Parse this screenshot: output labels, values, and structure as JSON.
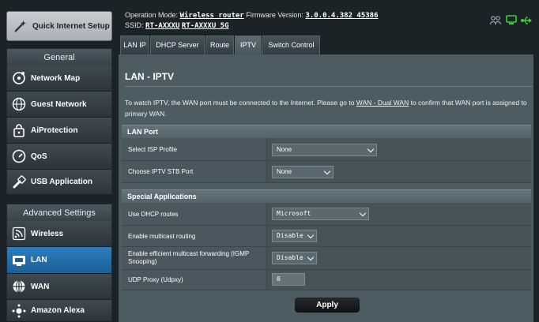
{
  "sidebar": {
    "quick_setup": "Quick Internet Setup",
    "general_title": "General",
    "general_items": [
      {
        "label": "Network Map",
        "icon": "network-map-icon"
      },
      {
        "label": "Guest Network",
        "icon": "guest-network-icon"
      },
      {
        "label": "AiProtection",
        "icon": "lock-icon"
      },
      {
        "label": "QoS",
        "icon": "speedometer-icon"
      },
      {
        "label": "USB Application",
        "icon": "usb-icon"
      }
    ],
    "advanced_title": "Advanced Settings",
    "advanced_items": [
      {
        "label": "Wireless",
        "icon": "wifi-icon"
      },
      {
        "label": "LAN",
        "icon": "lan-icon",
        "active": true
      },
      {
        "label": "WAN",
        "icon": "globe-icon"
      },
      {
        "label": "Amazon Alexa",
        "icon": "alexa-icon"
      }
    ]
  },
  "header": {
    "operation_mode_label": "Operation Mode:",
    "operation_mode_value": "Wireless router",
    "firmware_label": "Firmware Version:",
    "firmware_value": "3.0.0.4.382_45386",
    "ssid_label": "SSID:",
    "ssid_1": "RT-AXXXU",
    "ssid_2": "RT-AXXXU_5G"
  },
  "tabs": [
    "LAN IP",
    "DHCP Server",
    "Route",
    "IPTV",
    "Switch Control"
  ],
  "active_tab": "IPTV",
  "page": {
    "title": "LAN - IPTV",
    "description_pre": "To watch IPTV, the WAN port must be connected to the Internet. Please go to ",
    "description_link": "WAN - Dual WAN",
    "description_post": " to confirm that WAN port is assigned to primary WAN."
  },
  "lan_port": {
    "heading": "LAN Port",
    "isp_profile_label": "Select ISP Profile",
    "isp_profile_value": "None",
    "stb_port_label": "Choose IPTV STB Port",
    "stb_port_value": "None"
  },
  "special_apps": {
    "heading": "Special Applications",
    "dhcp_routes_label": "Use DHCP routes",
    "dhcp_routes_value": "Microsoft",
    "multicast_label": "Enable multicast routing",
    "multicast_value": "Disable",
    "efficient_multicast_label": "Enable efficient multicast forwarding (IGMP Snooping)",
    "efficient_multicast_value": "Disable",
    "udp_proxy_label": "UDP Proxy (Udpxy)",
    "udp_proxy_value": "0"
  },
  "apply_label": "Apply",
  "colors": {
    "accent": "#1d5f97",
    "status_green": "#3fcf3f"
  }
}
